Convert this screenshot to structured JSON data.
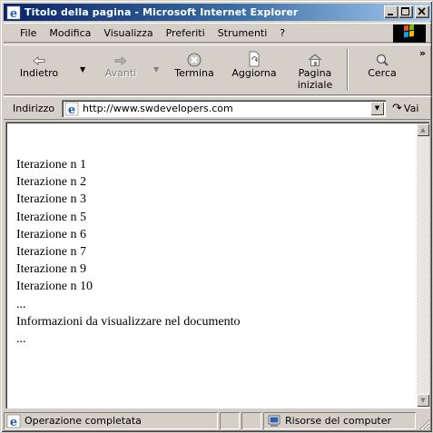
{
  "window": {
    "title": "Titolo della pagina - Microsoft Internet Explorer",
    "minimize": "_",
    "maximize": "□",
    "close": "✕"
  },
  "menu": [
    "File",
    "Modifica",
    "Visualizza",
    "Preferiti",
    "Strumenti",
    "?"
  ],
  "toolbar": {
    "back": "Indietro",
    "forward": "Avanti",
    "stop": "Termina",
    "refresh": "Aggiorna",
    "home_line1": "Pagina",
    "home_line2": "iniziale",
    "search": "Cerca",
    "more": "»"
  },
  "address": {
    "label": "Indirizzo",
    "url": "http://www.swdevelopers.com",
    "go": "Vai"
  },
  "document": {
    "lines": [
      "Iterazione n 1",
      "Iterazione n 2",
      "Iterazione n 3",
      "Iterazione n 5",
      "Iterazione n 6",
      "Iterazione n 7",
      "Iterazione n 9",
      "Iterazione n 10",
      "...",
      "Informazioni da visualizzare nel documento",
      "..."
    ]
  },
  "status": {
    "text": "Operazione completata",
    "zone": "Risorse del computer"
  },
  "colors": {
    "title_start": "#0a246a",
    "title_end": "#a6caf0",
    "face": "#d4d0c8"
  }
}
